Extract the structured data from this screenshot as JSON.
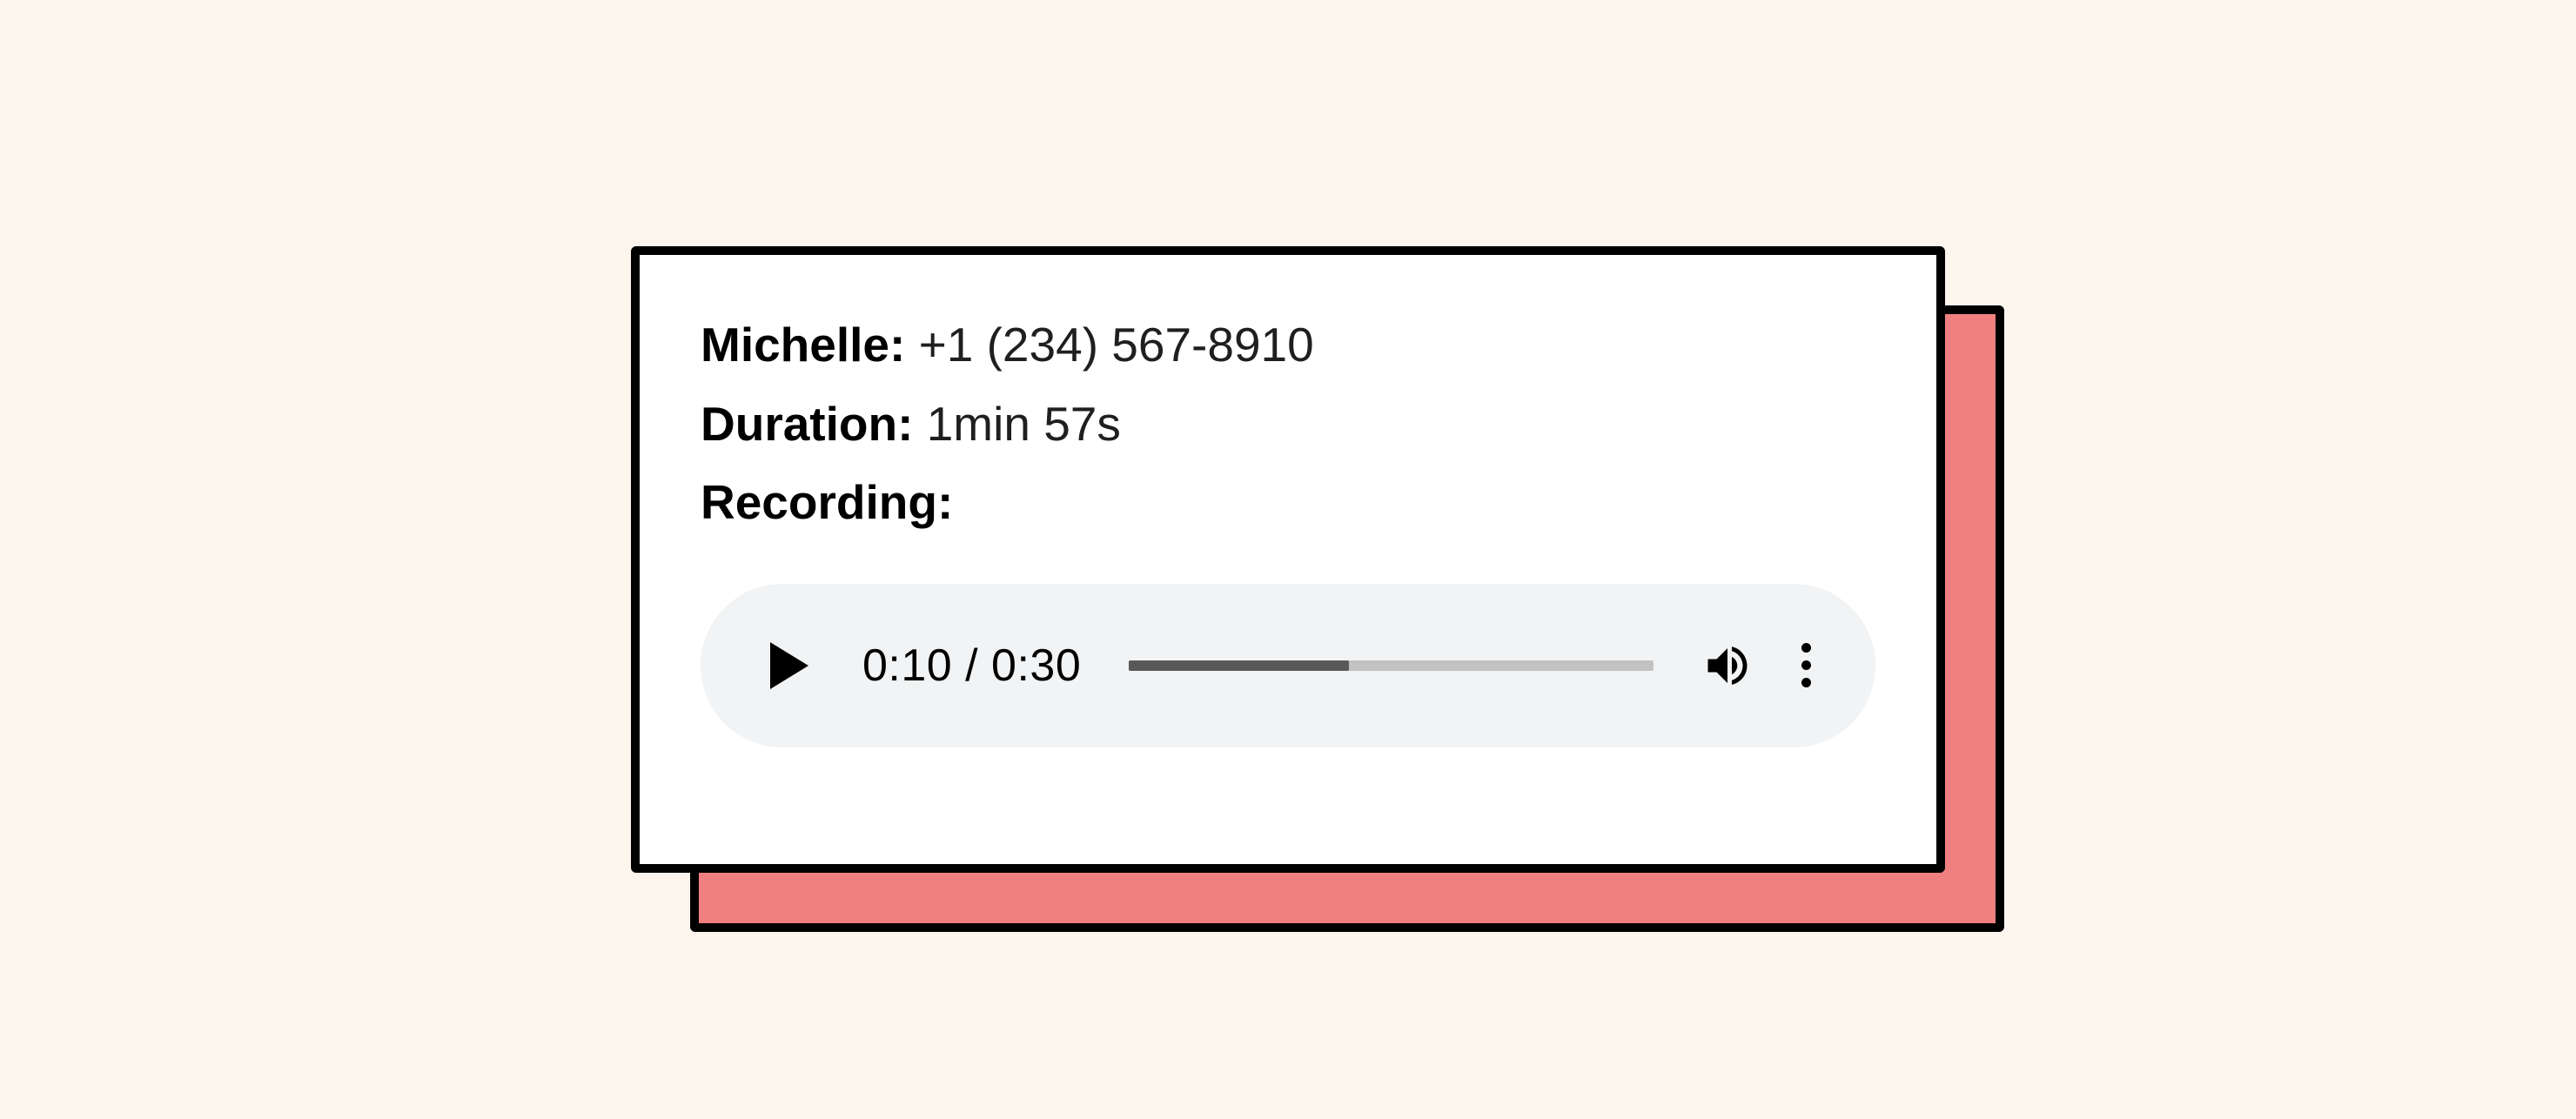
{
  "card": {
    "caller_label": "Michelle:",
    "caller_value": "+1 (234) 567-8910",
    "duration_label": "Duration:",
    "duration_value": "1min 57s",
    "recording_label": "Recording:"
  },
  "player": {
    "current_time": "0:10",
    "total_time": "0:30",
    "time_display": "0:10 / 0:30",
    "progress_percent": 42
  },
  "colors": {
    "background": "#fbf5ed",
    "card_bg": "#ffffff",
    "shadow_bg": "#f08080",
    "border": "#000000",
    "player_bg": "#f1f3f4"
  }
}
